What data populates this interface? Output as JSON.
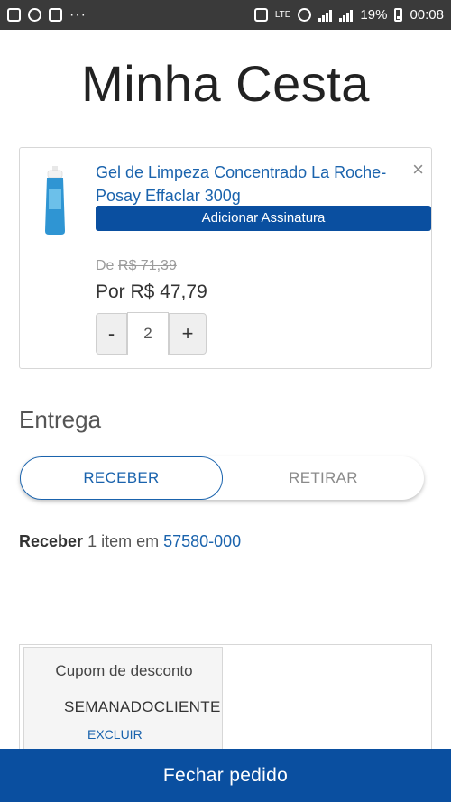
{
  "status_bar": {
    "battery": "19%",
    "time": "00:08",
    "network_small": "LTE"
  },
  "page": {
    "title": "Minha Cesta"
  },
  "cart_item": {
    "name": "Gel de Limpeza Concentrado La Roche-Posay Effaclar 300g",
    "subscription_label": "Adicionar Assinatura",
    "old_price_prefix": "De",
    "old_price": "R$ 71,39",
    "new_price": "Por R$ 47,79",
    "quantity": "2",
    "minus_label": "-",
    "plus_label": "+",
    "remove_icon": "×"
  },
  "delivery": {
    "title": "Entrega",
    "options": [
      "RECEBER",
      "RETIRAR"
    ],
    "selected": "RECEBER",
    "summary_bold": "Receber",
    "summary_text": "1 item em",
    "postal_code": "57580-000"
  },
  "coupon": {
    "label": "Cupom de desconto",
    "code": "SEMANADOCLIENTE",
    "remove_label": "EXCLUIR"
  },
  "checkout": {
    "label": "Fechar pedido"
  },
  "colors": {
    "brand_blue": "#0a4fa0",
    "link_blue": "#1a63ad"
  }
}
